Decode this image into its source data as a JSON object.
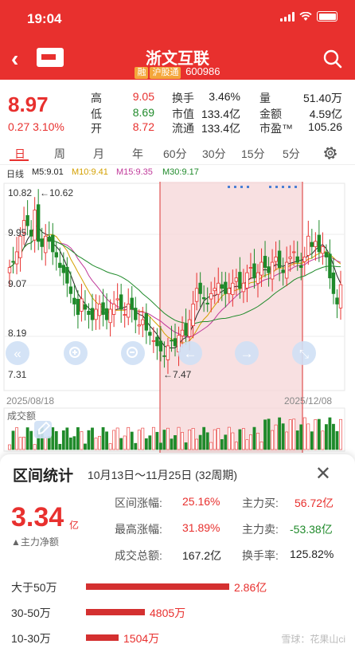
{
  "status": {
    "time": "19:04"
  },
  "header": {
    "title": "浙文互联",
    "tag1": "融",
    "tag2": "沪股通",
    "code": "600986"
  },
  "quote": {
    "price": "8.97",
    "change": "0.27 3.10%",
    "stats": [
      {
        "label": "高",
        "value": "9.05",
        "color": "red"
      },
      {
        "label": "换手",
        "value": "3.46%",
        "color": "blk"
      },
      {
        "label": "量",
        "value": "51.40万",
        "color": "blk"
      },
      {
        "label": "低",
        "value": "8.69",
        "color": "green"
      },
      {
        "label": "市值",
        "value": "133.4亿",
        "color": "blk"
      },
      {
        "label": "金额",
        "value": "4.59亿",
        "color": "blk"
      },
      {
        "label": "开",
        "value": "8.72",
        "color": "red"
      },
      {
        "label": "流通",
        "value": "133.4亿",
        "color": "blk"
      },
      {
        "label": "市盈™",
        "value": "105.26",
        "color": "blk"
      }
    ]
  },
  "tabs": [
    "日",
    "周",
    "月",
    "年",
    "60分",
    "30分",
    "15分",
    "5分"
  ],
  "ma": {
    "label": "日线",
    "m5": "M5:9.01",
    "m10": "M10:9.41",
    "m15": "M15:9.35",
    "m30": "M30:9.17"
  },
  "chart_data": {
    "type": "candlestick",
    "y_ticks": [
      "10.82",
      "9.95",
      "9.07",
      "8.19",
      "7.31"
    ],
    "ylim": [
      7.31,
      10.82
    ],
    "annotations": [
      "←10.62",
      "←7.47"
    ],
    "x_labels": [
      "2025/08/18",
      "2025/12/08"
    ],
    "volume_label": "成交额",
    "selected_range": "10月13日～11月25日"
  },
  "panel": {
    "title": "区间统计",
    "range": "10月13日～11月25日 (32周期)",
    "net_value": "3.34",
    "net_unit": "亿",
    "net_label": "▲主力净额",
    "stats": [
      {
        "label": "区间涨幅:",
        "value": "25.16%"
      },
      {
        "label": "主力买:",
        "value": "56.72亿"
      },
      {
        "label": "最高涨幅:",
        "value": "31.89%"
      },
      {
        "label": "主力卖:",
        "value": "-53.38亿"
      },
      {
        "label": "成交总额:",
        "value": "167.2亿"
      },
      {
        "label": "换手率:",
        "value": "125.82%"
      }
    ],
    "bars": [
      {
        "label": "大于50万",
        "value": "2.86亿",
        "amount": 2.86
      },
      {
        "label": "30-50万",
        "value": "4805万",
        "amount": 0.4805
      },
      {
        "label": "10-30万",
        "value": "1504万",
        "amount": 0.1504
      }
    ]
  },
  "watermark": "雪球：花果山ci"
}
